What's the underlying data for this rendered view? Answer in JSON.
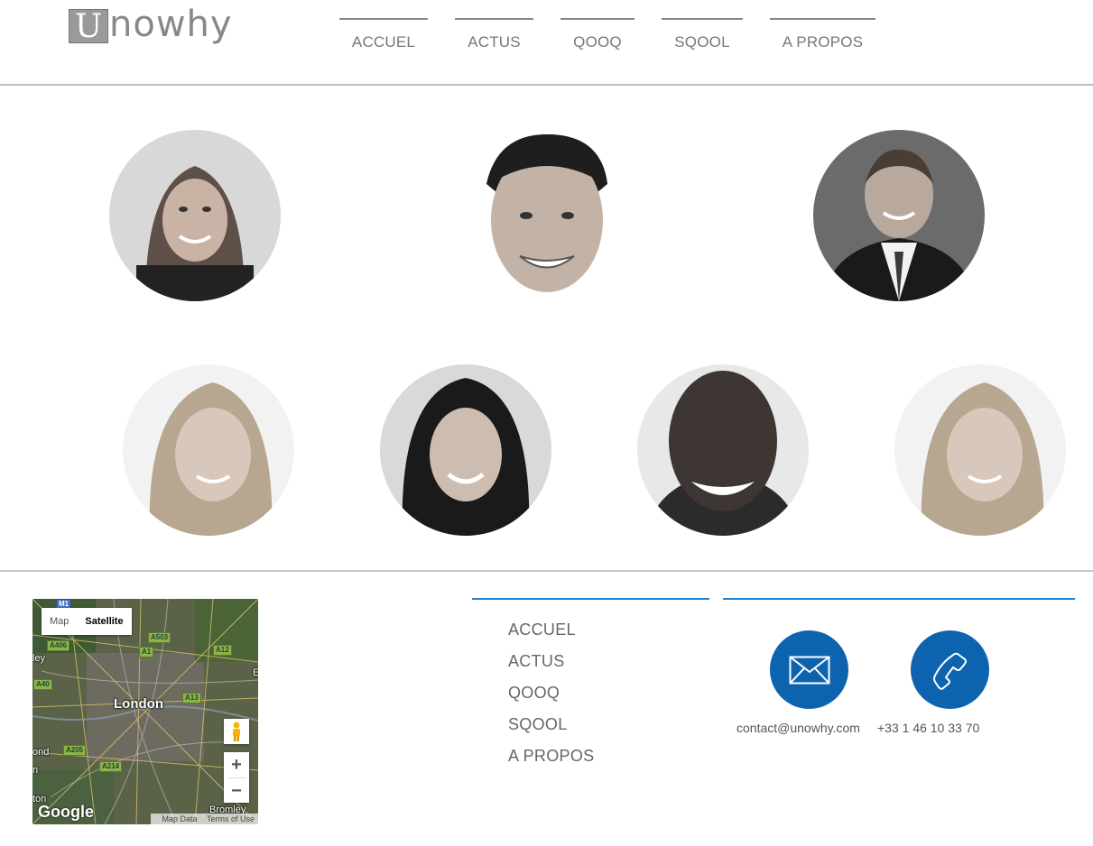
{
  "header": {
    "logo_letter": "U",
    "logo_rest": "nowhy",
    "nav": [
      "ACCUEL",
      "ACTUS",
      "QOOQ",
      "SQOOL",
      "A PROPOS"
    ]
  },
  "team": {
    "members": [
      "portrait-woman-1",
      "portrait-man-1",
      "portrait-man-2",
      "portrait-woman-2",
      "portrait-woman-3",
      "portrait-man-3",
      "portrait-woman-4"
    ]
  },
  "map": {
    "type_map": "Map",
    "type_satellite": "Satellite",
    "city": "London",
    "places": [
      "ley",
      "A40",
      "ond",
      "n",
      "ton",
      "Bromley",
      "E"
    ],
    "roads": [
      "M1",
      "A406",
      "A503",
      "A1",
      "A12",
      "A13",
      "A205",
      "A214"
    ],
    "zoom_in": "+",
    "zoom_out": "−",
    "brand": "Google",
    "map_data": "Map Data",
    "terms": "Terms of Use"
  },
  "footer": {
    "nav": [
      "ACCUEL",
      "ACTUS",
      "QOOQ",
      "SQOOL",
      "A PROPOS"
    ],
    "email": "contact@unowhy.com",
    "phone": "+33 1 46 10 33 70",
    "accent": "#1f82d2",
    "icon_bg": "#0e63b0"
  }
}
